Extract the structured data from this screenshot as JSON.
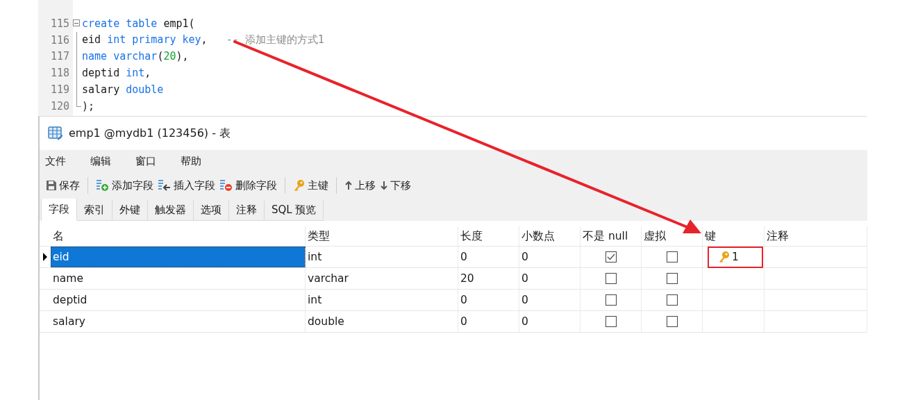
{
  "editor": {
    "lines": [
      {
        "number": "115",
        "tokens": [
          {
            "text": "create table",
            "kind": "keyword"
          },
          {
            "text": " emp1(",
            "kind": "plain"
          }
        ]
      },
      {
        "number": "116",
        "tokens": [
          {
            "text": "eid ",
            "kind": "plain"
          },
          {
            "text": "int primary key",
            "kind": "keyword"
          },
          {
            "text": ",   ",
            "kind": "plain"
          },
          {
            "text": "-- 添加主键的方式1",
            "kind": "comment"
          }
        ]
      },
      {
        "number": "117",
        "tokens": [
          {
            "text": "name varchar",
            "kind": "keyword"
          },
          {
            "text": "(",
            "kind": "plain"
          },
          {
            "text": "20",
            "kind": "number"
          },
          {
            "text": "),",
            "kind": "plain"
          }
        ]
      },
      {
        "number": "118",
        "tokens": [
          {
            "text": "deptid ",
            "kind": "plain"
          },
          {
            "text": "int",
            "kind": "keyword"
          },
          {
            "text": ",",
            "kind": "plain"
          }
        ]
      },
      {
        "number": "119",
        "tokens": [
          {
            "text": "salary ",
            "kind": "plain"
          },
          {
            "text": "double",
            "kind": "keyword"
          }
        ]
      },
      {
        "number": "120",
        "tokens": [
          {
            "text": ");",
            "kind": "plain"
          }
        ]
      }
    ]
  },
  "window": {
    "title": "emp1 @mydb1 (123456) - 表",
    "menu": [
      "文件",
      "编辑",
      "窗口",
      "帮助"
    ],
    "toolbar": [
      {
        "label": "保存",
        "kind": "save"
      },
      {
        "kind": "separator"
      },
      {
        "label": "添加字段",
        "kind": "add"
      },
      {
        "label": "插入字段",
        "kind": "insert"
      },
      {
        "label": "删除字段",
        "kind": "delete"
      },
      {
        "kind": "separator"
      },
      {
        "label": "主键",
        "kind": "key"
      },
      {
        "kind": "separator"
      },
      {
        "label": "上移",
        "kind": "up"
      },
      {
        "label": "下移",
        "kind": "down"
      }
    ],
    "tabs": [
      {
        "label": "字段",
        "selected": true
      },
      {
        "label": "索引",
        "selected": false
      },
      {
        "label": "外键",
        "selected": false
      },
      {
        "label": "触发器",
        "selected": false
      },
      {
        "label": "选项",
        "selected": false
      },
      {
        "label": "注释",
        "selected": false
      },
      {
        "label": "SQL 预览",
        "selected": false
      }
    ],
    "table": {
      "columns": [
        "名",
        "类型",
        "长度",
        "小数点",
        "不是 null",
        "虚拟",
        "键",
        "注释"
      ],
      "rows": [
        {
          "name": "eid",
          "type": "int",
          "length": "0",
          "decimals": "0",
          "not_null": true,
          "virtual": false,
          "primary_key": true,
          "key": "1",
          "selected": true
        },
        {
          "name": "name",
          "type": "varchar",
          "length": "20",
          "decimals": "0",
          "not_null": false,
          "virtual": false,
          "primary_key": false,
          "selected": false
        },
        {
          "name": "deptid",
          "type": "int",
          "length": "0",
          "decimals": "0",
          "not_null": false,
          "virtual": false,
          "primary_key": false,
          "selected": false
        },
        {
          "name": "salary",
          "type": "double",
          "length": "0",
          "decimals": "0",
          "not_null": false,
          "virtual": false,
          "primary_key": false,
          "selected": false
        }
      ]
    }
  }
}
